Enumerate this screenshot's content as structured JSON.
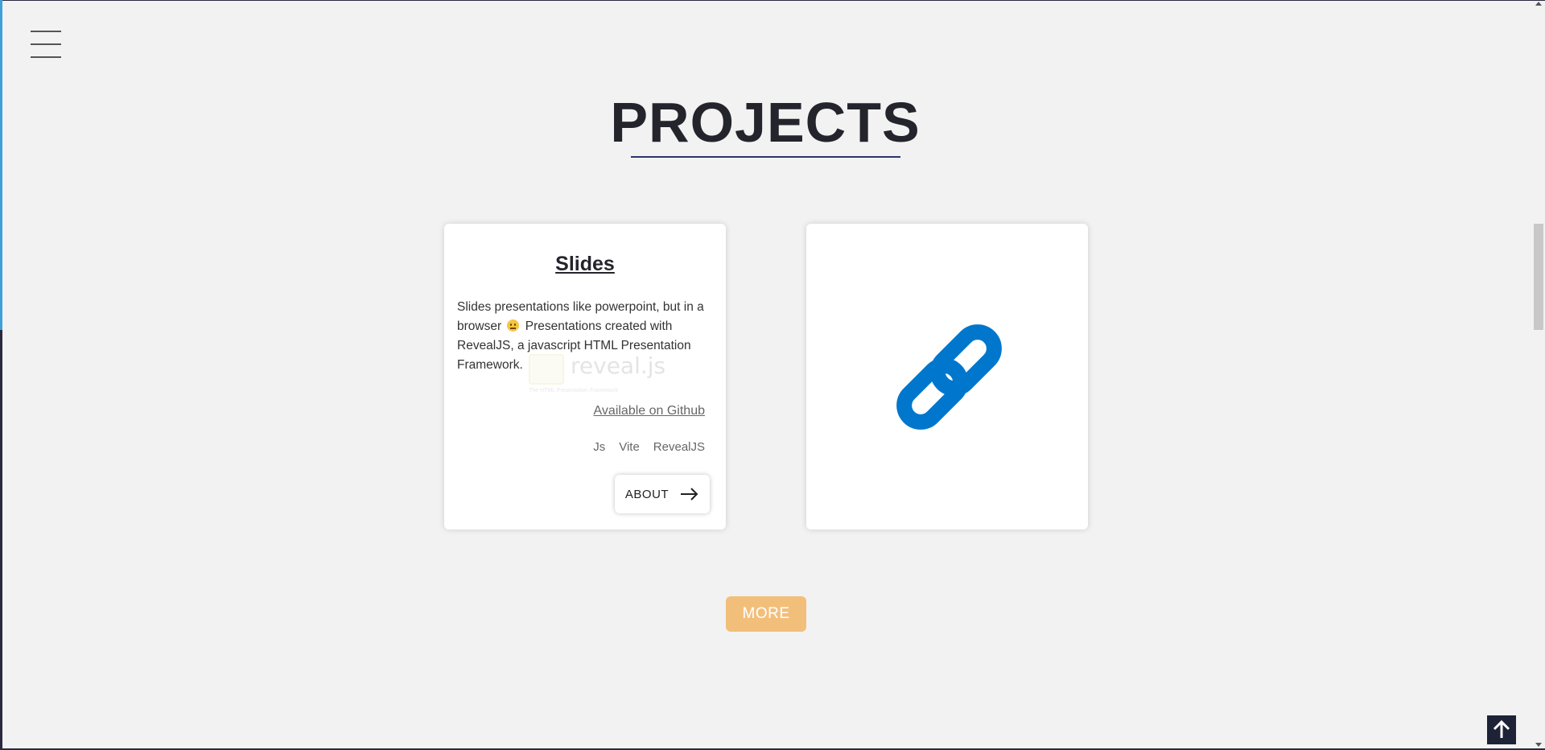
{
  "nav": {
    "menu_icon": "hamburger-menu-icon"
  },
  "section": {
    "title": "PROJECTS"
  },
  "projects": [
    {
      "title": "Slides",
      "description_before_emoji": "Slides presentations like powerpoint, but in a browser",
      "emoji_icon": "neutral-face-emoji",
      "description_after_emoji": "Presentations created with RevealJS, a javascript HTML Presentation Framework.",
      "background_logo_text": "reveal.js",
      "background_logo_subtitle": "The HTML Presentation Framework",
      "github_label": "Available on Github",
      "tags": [
        "Js",
        "Vite",
        "RevealJS"
      ],
      "about_label": "ABOUT",
      "about_icon": "arrow-right-icon"
    },
    {
      "icon": "link-icon",
      "icon_color": "#0077cc"
    }
  ],
  "more_label": "MORE",
  "colors": {
    "background": "#f2f2f2",
    "more_button": "#f2bf7a",
    "title_underline": "#2d3470",
    "accent_blue": "#3fa1d9",
    "back_to_top": "#1e2237"
  },
  "back_to_top_icon": "arrow-up-icon"
}
